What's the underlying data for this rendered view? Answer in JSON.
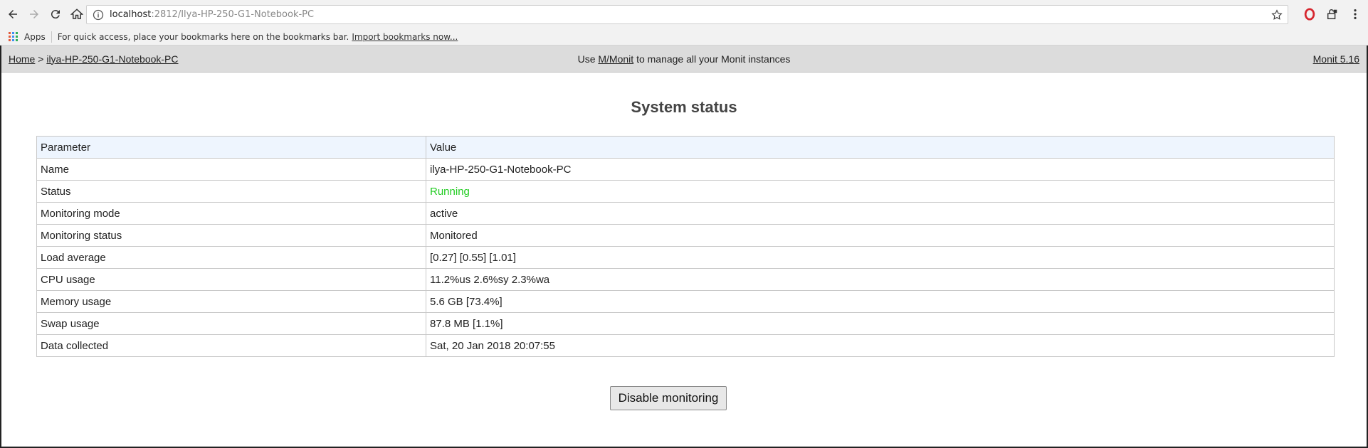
{
  "browser": {
    "url_host": "localhost",
    "url_path": ":2812/Ilya-HP-250-G1-Notebook-PC",
    "bookmarks_bar": {
      "apps_label": "Apps",
      "hint": "For quick access, place your bookmarks here on the bookmarks bar.",
      "import_link": "Import bookmarks now..."
    }
  },
  "header": {
    "breadcrumb_home": "Home",
    "breadcrumb_sep": ">",
    "breadcrumb_host": "ilya-HP-250-G1-Notebook-PC",
    "center_prefix": "Use",
    "center_link": "M/Monit",
    "center_suffix": "to manage all your Monit instances",
    "version_link": "Monit 5.16"
  },
  "main": {
    "title": "System status",
    "table": {
      "headers": [
        "Parameter",
        "Value"
      ],
      "rows": [
        [
          "Name",
          "ilya-HP-250-G1-Notebook-PC"
        ],
        [
          "Status",
          "Running"
        ],
        [
          "Monitoring mode",
          "active"
        ],
        [
          "Monitoring status",
          "Monitored"
        ],
        [
          "Load average",
          "[0.27] [0.55] [1.01]"
        ],
        [
          "CPU usage",
          "11.2%us 2.6%sy 2.3%wa"
        ],
        [
          "Memory usage",
          "5.6 GB [73.4%]"
        ],
        [
          "Swap usage",
          "87.8 MB [1.1%]"
        ],
        [
          "Data collected",
          "Sat, 20 Jan 2018 20:07:55"
        ]
      ]
    },
    "disable_button": "Disable monitoring"
  },
  "colors": {
    "status_running": "#22cc22",
    "header_bg": "#dcdcdc",
    "table_header_bg": "#eef5fe"
  }
}
